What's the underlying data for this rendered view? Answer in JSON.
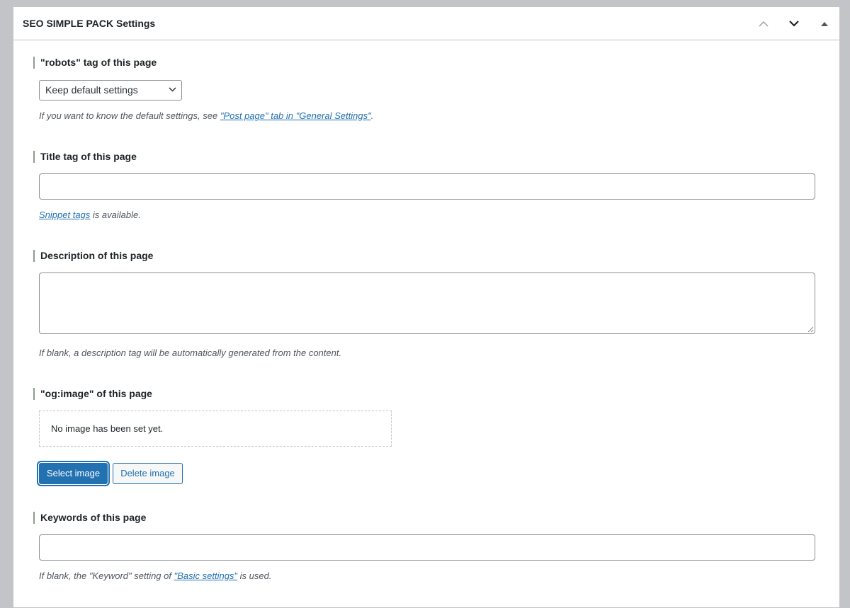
{
  "panel": {
    "title": "SEO SIMPLE PACK Settings",
    "actions": [
      "chevron-up-icon",
      "chevron-down-icon",
      "triangle-up-icon"
    ]
  },
  "robots": {
    "label": "\"robots\" tag of this page",
    "select_value": "Keep default settings",
    "help_prefix": "If you want to know the default settings, see ",
    "help_link": "\"Post page\" tab in \"General Settings\"",
    "help_suffix": "."
  },
  "title_tag": {
    "label": "Title tag of this page",
    "value": "",
    "help_link": "Snippet tags",
    "help_suffix": " is available."
  },
  "description": {
    "label": "Description of this page",
    "value": "",
    "help": "If blank, a description tag will be automatically generated from the content."
  },
  "og_image": {
    "label": "\"og:image\" of this page",
    "empty_text": "No image has been set yet.",
    "select_label": "Select image",
    "delete_label": "Delete image"
  },
  "keywords": {
    "label": "Keywords of this page",
    "value": "",
    "help_prefix": "If blank, the \"Keyword\" setting of ",
    "help_link": "\"Basic settings\"",
    "help_suffix": " is used."
  }
}
